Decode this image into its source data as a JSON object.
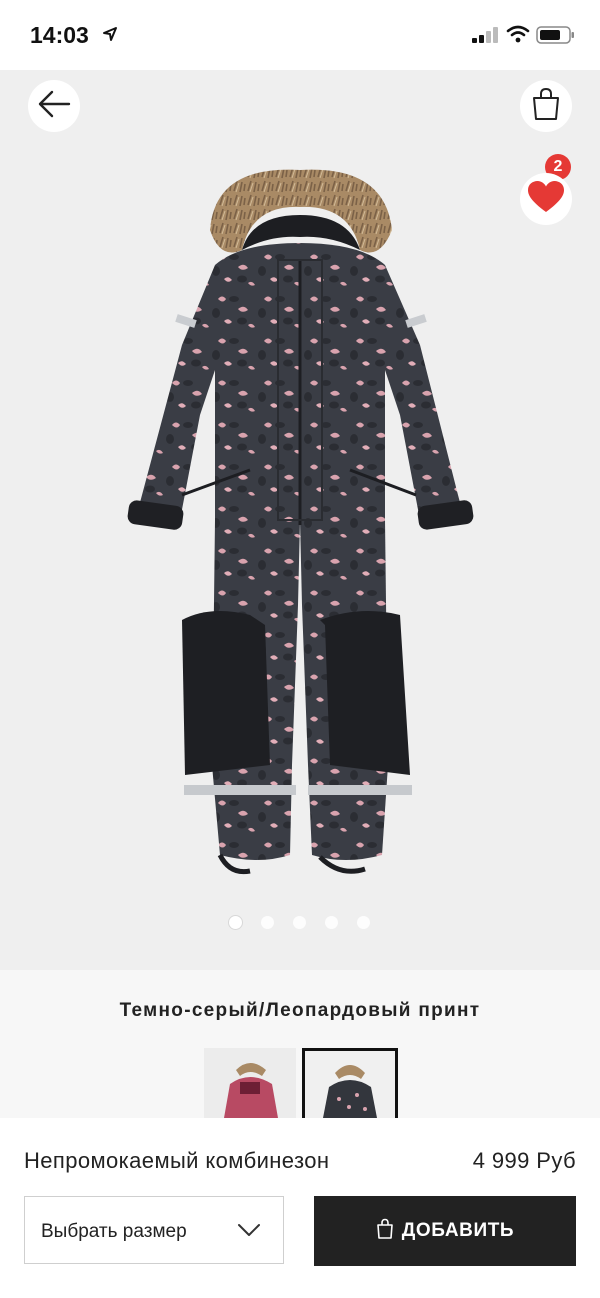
{
  "status_bar": {
    "time": "14:03",
    "icons": [
      "location-arrow-icon",
      "cellular-signal-icon",
      "wifi-icon",
      "battery-icon"
    ]
  },
  "gallery": {
    "icons": {
      "back": "arrow-left-icon",
      "bag": "shopping-bag-icon",
      "favorite": "heart-icon"
    },
    "cart_count": "2",
    "favorite_color": "#e53935",
    "pages": 5,
    "active_page": 1
  },
  "product": {
    "color_name": "Темно-серый/Леопардовый принт",
    "name": "Непромокаемый комбинезон",
    "price": "4 999 Руб",
    "swatches": [
      {
        "color": "#b84a63",
        "selected": false
      },
      {
        "color": "#33363d",
        "selected": true
      }
    ]
  },
  "actions": {
    "size_select_label": "Выбрать размер",
    "add_label": "ДОБАВИТЬ",
    "add_button_color": "#222222"
  }
}
